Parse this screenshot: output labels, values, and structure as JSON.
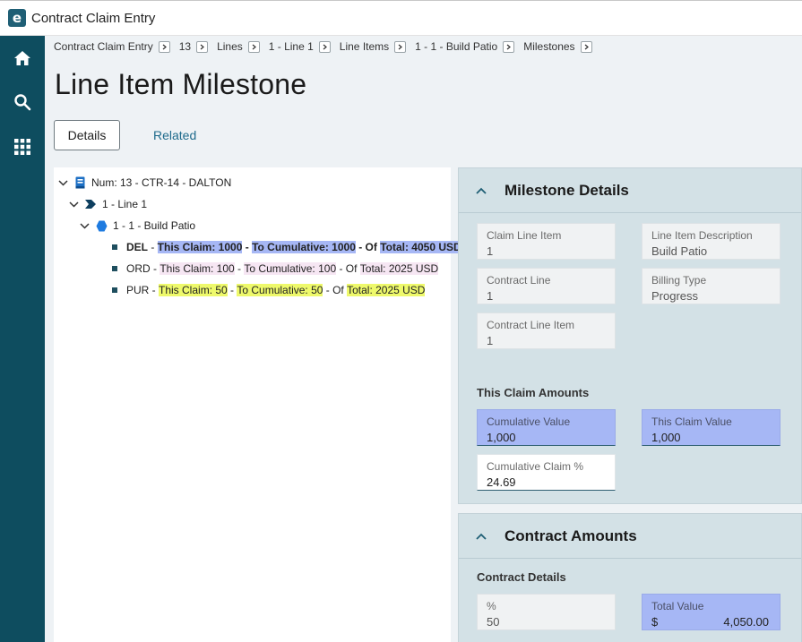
{
  "app": {
    "logo_letter": "e",
    "title": "Contract Claim Entry"
  },
  "nav": {
    "items": [
      "home-icon",
      "search-icon",
      "apps-grid-icon"
    ]
  },
  "breadcrumb": [
    "Contract Claim Entry",
    "13",
    "Lines",
    "1 - Line 1",
    "Line Items",
    "1 - 1 - Build Patio",
    "Milestones"
  ],
  "page": {
    "title": "Line Item Milestone"
  },
  "tabs": {
    "details": "Details",
    "related": "Related"
  },
  "tree": {
    "root": "Num: 13 - CTR-14 - DALTON",
    "line": "1 - Line 1",
    "item": "1 - 1 - Build Patio",
    "milestones": [
      {
        "code": "DEL",
        "dash1": " - ",
        "claim": "This Claim: 1000",
        "dash2": " - ",
        "cumulative": "To Cumulative: 1000",
        "dash3": " - Of ",
        "total": "Total: 4050 USD"
      },
      {
        "code": "ORD",
        "dash1": " - ",
        "claim": "This Claim: 100",
        "dash2": " - ",
        "cumulative": "To Cumulative: 100",
        "dash3": " - Of ",
        "total": "Total: 2025 USD"
      },
      {
        "code": "PUR",
        "dash1": " - ",
        "claim": "This Claim: 50",
        "dash2": " - ",
        "cumulative": "To Cumulative: 50",
        "dash3": " - Of ",
        "total": "Total: 2025 USD"
      }
    ]
  },
  "milestone_details": {
    "title": "Milestone Details",
    "claim_line_item": {
      "label": "Claim Line Item",
      "value": "1"
    },
    "line_item_description": {
      "label": "Line Item Description",
      "value": "Build Patio"
    },
    "contract_line": {
      "label": "Contract Line",
      "value": "1"
    },
    "billing_type": {
      "label": "Billing Type",
      "value": "Progress"
    },
    "contract_line_item": {
      "label": "Contract Line Item",
      "value": "1"
    },
    "claim_amounts_heading": "This Claim Amounts",
    "cumulative_value": {
      "label": "Cumulative Value",
      "value": "1,000"
    },
    "this_claim_value": {
      "label": "This Claim Value",
      "value": "1,000"
    },
    "cumulative_claim_pct": {
      "label": "Cumulative Claim %",
      "value": "24.69"
    }
  },
  "contract_amounts": {
    "title": "Contract Amounts",
    "details_heading": "Contract Details",
    "percent": {
      "label": "%",
      "value": "50"
    },
    "total_value": {
      "label": "Total Value",
      "currency": "$",
      "value": "4,050.00"
    }
  },
  "colors": {
    "nav": "#0e4d5f",
    "highlight_blue": "#a6b7f5",
    "highlight_yellow": "#eef96b",
    "panel": "#d3e1e6"
  }
}
